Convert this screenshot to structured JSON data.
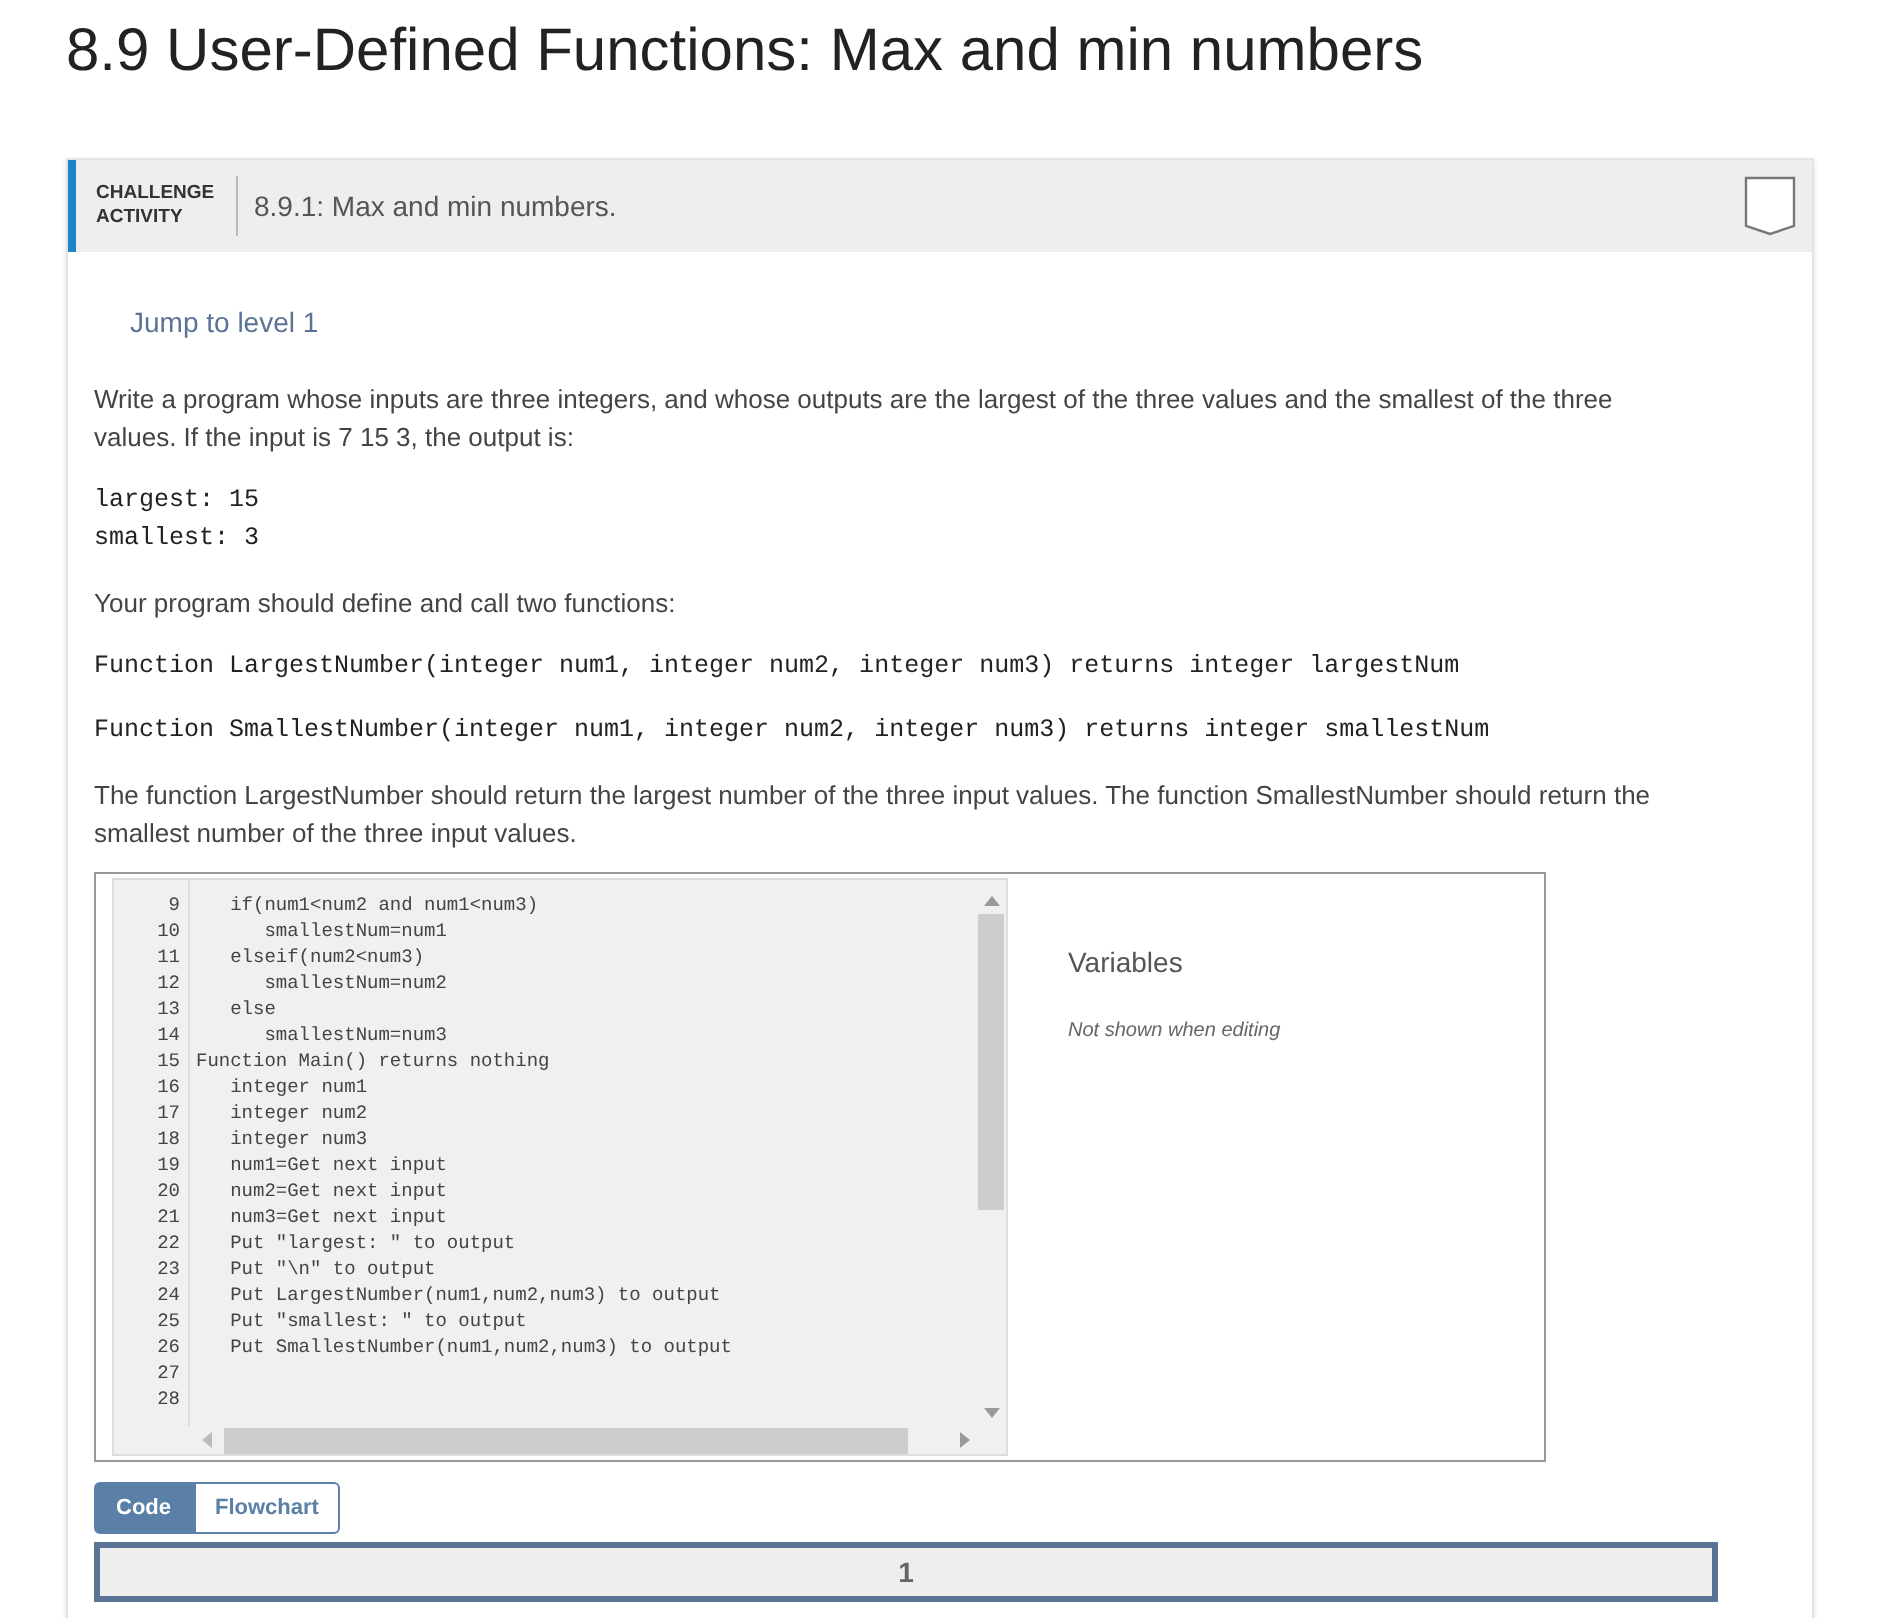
{
  "title": "8.9 User-Defined Functions: Max and min numbers",
  "activity": {
    "label": "CHALLENGE ACTIVITY",
    "title": "8.9.1: Max and min numbers."
  },
  "jump_link": "Jump to level 1",
  "blocks": [
    {
      "kind": "text",
      "text": "Write a program whose inputs are three integers, and whose outputs are the largest of the three values and the smallest of the three values. If the input is 7 15 3, the output is:"
    },
    {
      "kind": "code",
      "lines": [
        "largest: 15",
        "smallest: 3"
      ]
    },
    {
      "kind": "text",
      "text": "Your program should define and call two functions:"
    },
    {
      "kind": "code",
      "lines": [
        "Function LargestNumber(integer num1, integer num2, integer num3) returns integer largestNum"
      ]
    },
    {
      "kind": "code",
      "lines": [
        "Function SmallestNumber(integer num1, integer num2, integer num3) returns integer smallestNum"
      ]
    },
    {
      "kind": "text",
      "text": "The function LargestNumber should return the largest number of the three input values. The function SmallestNumber should return the smallest number of the three input values."
    }
  ],
  "editor": {
    "lines": [
      {
        "number": "9",
        "text": "   if(num1<num2 and num1<num3)"
      },
      {
        "number": "10",
        "text": "      smallestNum=num1"
      },
      {
        "number": "11",
        "text": "   elseif(num2<num3)"
      },
      {
        "number": "12",
        "text": "      smallestNum=num2"
      },
      {
        "number": "13",
        "text": "   else"
      },
      {
        "number": "14",
        "text": "      smallestNum=num3"
      },
      {
        "number": "15",
        "text": "Function Main() returns nothing"
      },
      {
        "number": "16",
        "text": "   integer num1"
      },
      {
        "number": "17",
        "text": "   integer num2"
      },
      {
        "number": "18",
        "text": "   integer num3"
      },
      {
        "number": "19",
        "text": "   num1=Get next input"
      },
      {
        "number": "20",
        "text": "   num2=Get next input"
      },
      {
        "number": "21",
        "text": "   num3=Get next input"
      },
      {
        "number": "22",
        "text": "   Put \"largest: \" to output"
      },
      {
        "number": "23",
        "text": "   Put \"\\n\" to output"
      },
      {
        "number": "24",
        "text": "   Put LargestNumber(num1,num2,num3) to output"
      },
      {
        "number": "25",
        "text": "   Put \"smallest: \" to output"
      },
      {
        "number": "26",
        "text": "   Put SmallestNumber(num1,num2,num3) to output"
      },
      {
        "number": "27"
      },
      {
        "number": "28"
      }
    ],
    "variables_title": "Variables",
    "variables_note": "Not shown when editing"
  },
  "tabs": [
    {
      "label": "Code",
      "selected": true
    },
    {
      "label": "Flowchart",
      "selected": false
    }
  ],
  "levels": [
    {
      "label": "1"
    }
  ]
}
